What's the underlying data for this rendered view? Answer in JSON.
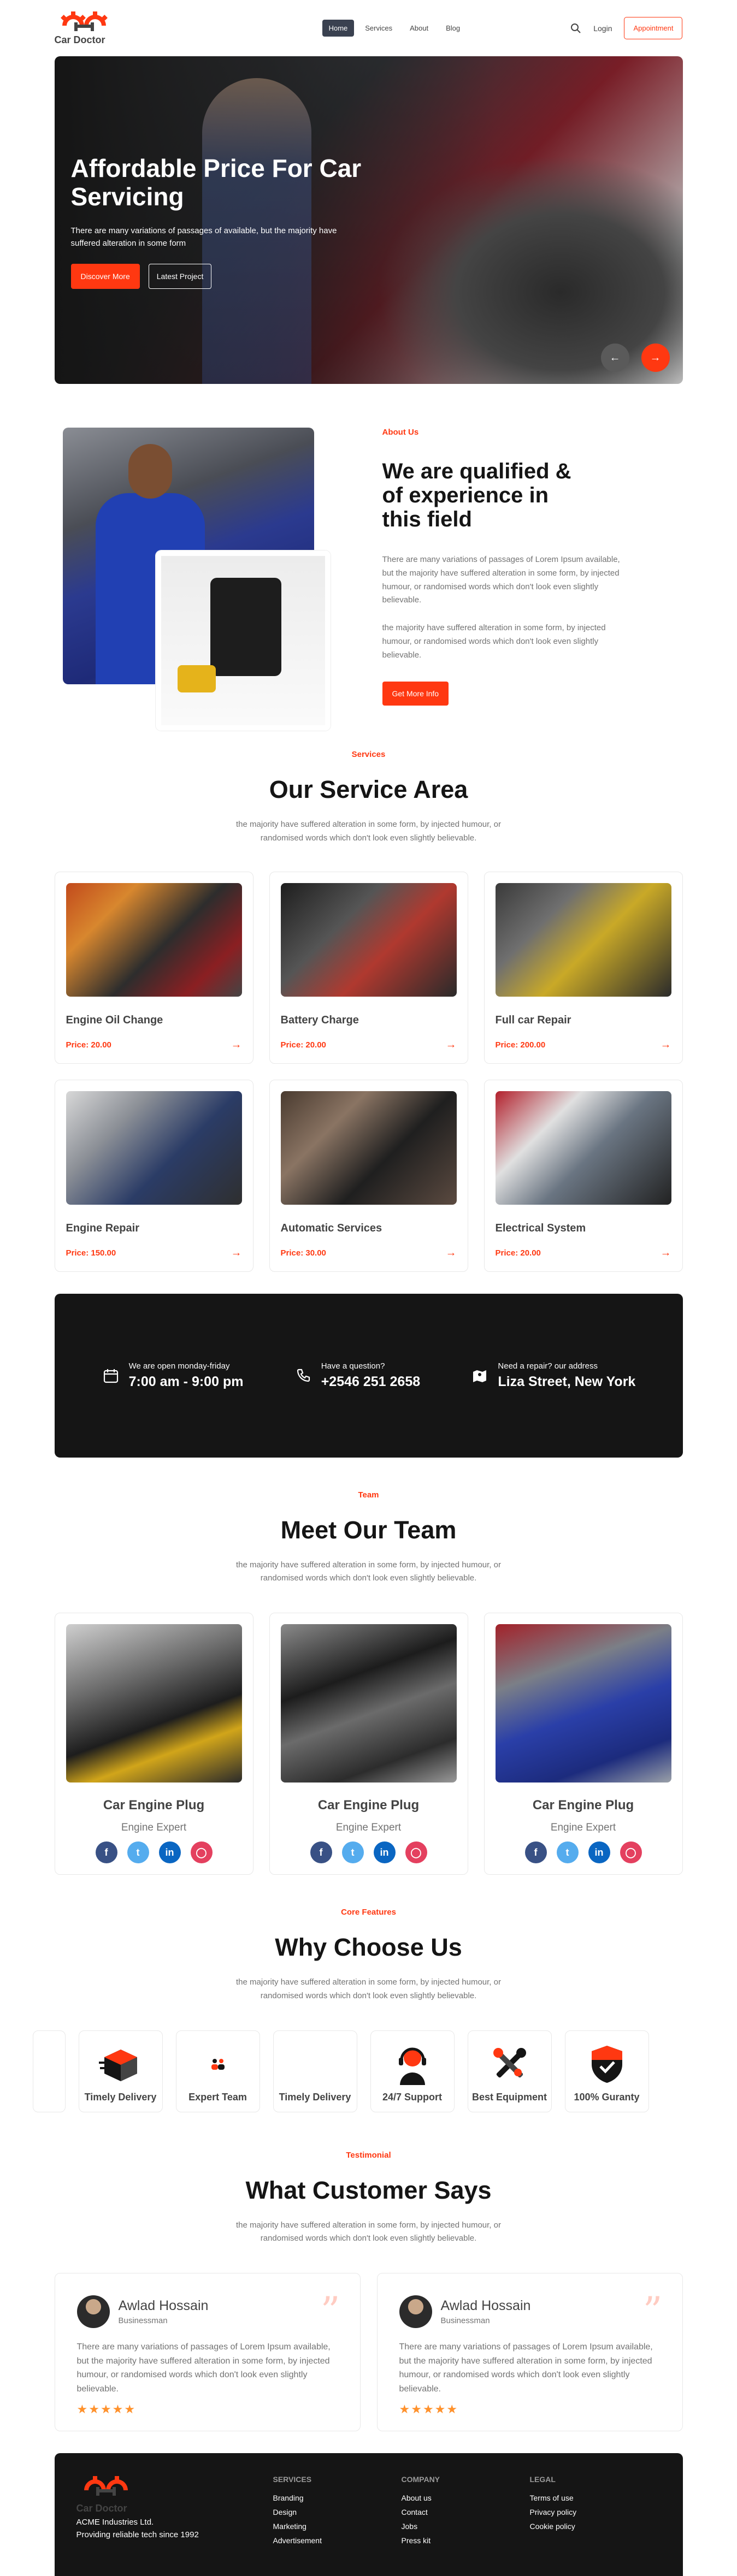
{
  "brand": {
    "name": "Car Doctor",
    "accent": "#FF3811",
    "dark": "#151515"
  },
  "nav": {
    "links": [
      "Home",
      "Services",
      "About",
      "Blog"
    ],
    "active": "Home",
    "login": "Login",
    "cta": "Appointment"
  },
  "hero": {
    "title": "Affordable Price For Car Servicing",
    "text": "There are many variations of passages of available, but the majority have suffered alteration in some form",
    "primary_btn": "Discover More",
    "secondary_btn": "Latest Project",
    "prev_icon": "arrow-left-icon",
    "next_icon": "arrow-right-icon"
  },
  "about": {
    "eyebrow": "About Us",
    "title": "We are qualified & of experience in this field",
    "para1": "There are many variations of passages of Lorem Ipsum available, but the majority have suffered alteration in some form, by injected humour, or randomised words which don't look even slightly believable.",
    "para2": "the majority have suffered alteration in some form, by injected humour, or randomised words which don't look even slightly believable.",
    "button": "Get More Info"
  },
  "services": {
    "eyebrow": "Services",
    "title": "Our Service Area",
    "subtitle": "the majority have suffered alteration in some form, by injected humour, or randomised words which don't look even slightly believable.",
    "items": [
      {
        "title": "Engine Oil Change",
        "price": "Price: 20.00"
      },
      {
        "title": "Battery Charge",
        "price": "Price: 20.00"
      },
      {
        "title": "Full car Repair",
        "price": "Price: 200.00"
      },
      {
        "title": "Engine Repair",
        "price": "Price: 150.00"
      },
      {
        "title": "Automatic Services",
        "price": "Price: 30.00"
      },
      {
        "title": "Electrical System",
        "price": "Price: 20.00"
      }
    ]
  },
  "info": [
    {
      "icon": "calendar-icon",
      "small": "We are open monday-friday",
      "big": "7:00 am - 9:00 pm"
    },
    {
      "icon": "phone-icon",
      "small": "Have a question?",
      "big": "+2546 251 2658"
    },
    {
      "icon": "map-icon",
      "small": "Need a repair? our address",
      "big": "Liza Street, New York"
    }
  ],
  "team": {
    "eyebrow": "Team",
    "title": "Meet Our Team",
    "subtitle": "the majority have suffered alteration in some form, by injected humour, or randomised words which don't look even slightly believable.",
    "members": [
      {
        "name": "Car Engine Plug",
        "role": "Engine Expert"
      },
      {
        "name": "Car Engine Plug",
        "role": "Engine Expert"
      },
      {
        "name": "Car Engine Plug",
        "role": "Engine Expert"
      }
    ]
  },
  "why": {
    "eyebrow": "Core Features",
    "title": "Why Choose Us",
    "subtitle": "the majority have suffered alteration in some form, by injected humour, or randomised words which don't look even slightly believable.",
    "features": [
      {
        "label": "Timely Delivery",
        "icon": "fast-box-icon"
      },
      {
        "label": "Expert Team",
        "icon": "group-icon"
      },
      {
        "label": "Timely Delivery",
        "icon": ""
      },
      {
        "label": "24/7 Support",
        "icon": "headset-icon"
      },
      {
        "label": "Best Equipment",
        "icon": "tools-icon"
      },
      {
        "label": "100% Guranty",
        "icon": "shield-check-icon"
      }
    ]
  },
  "testimonial": {
    "eyebrow": "Testimonial",
    "title": "What Customer Says",
    "subtitle": "the majority have suffered alteration in some form, by injected humour, or randomised words which don't look even slightly believable.",
    "reviews": [
      {
        "name": "Awlad Hossain",
        "role": "Businessman",
        "text": "There are many variations of passages of Lorem Ipsum available, but the majority have suffered alteration in some form, by injected humour, or randomised words which don't look even slightly believable.",
        "rating": 5
      },
      {
        "name": "Awlad Hossain",
        "role": "Businessman",
        "text": "There are many variations of passages of Lorem Ipsum available, but the majority have suffered alteration in some form, by injected humour, or randomised words which don't look even slightly believable.",
        "rating": 5
      }
    ]
  },
  "footer": {
    "company_name": "ACME Industries Ltd.",
    "tagline": "Providing reliable tech since 1992",
    "columns": [
      {
        "title": "SERVICES",
        "links": [
          "Branding",
          "Design",
          "Marketing",
          "Advertisement"
        ]
      },
      {
        "title": "COMPANY",
        "links": [
          "About us",
          "Contact",
          "Jobs",
          "Press kit"
        ]
      },
      {
        "title": "LEGAL",
        "links": [
          "Terms of use",
          "Privacy policy",
          "Cookie policy"
        ]
      }
    ]
  }
}
